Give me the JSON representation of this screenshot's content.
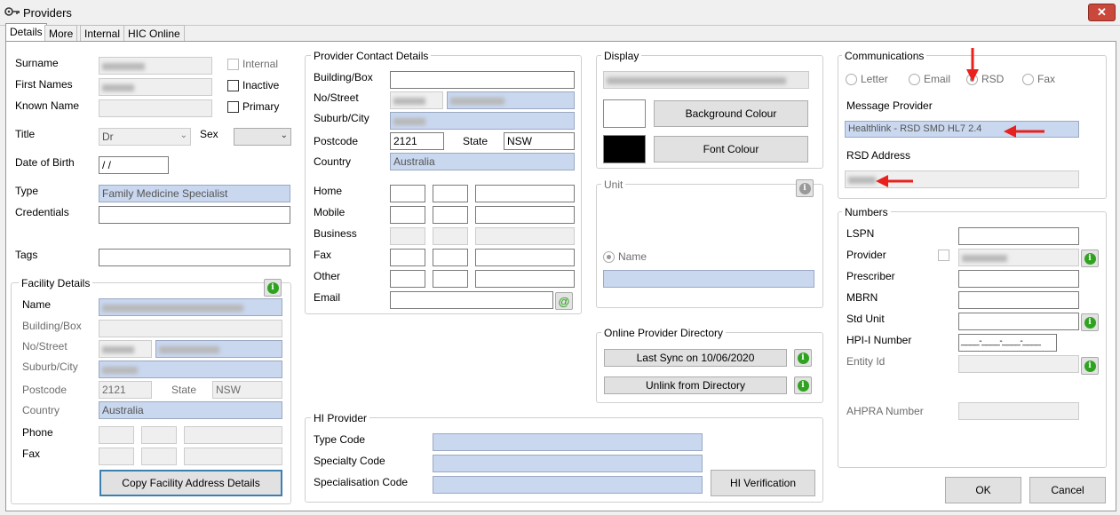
{
  "window": {
    "title": "Providers",
    "close_symbol": "✕"
  },
  "tabs": [
    "Details",
    "More",
    "Internal",
    "HIC Online"
  ],
  "personal": {
    "surname_label": "Surname",
    "first_names_label": "First Names",
    "known_name_label": "Known Name",
    "title_label": "Title",
    "title_value": "Dr",
    "sex_label": "Sex",
    "dob_label": "Date of Birth",
    "dob_value": " /  /",
    "type_label": "Type",
    "type_value": "Family Medicine Specialist",
    "credentials_label": "Credentials",
    "tags_label": "Tags",
    "internal_label": "Internal",
    "inactive_label": "Inactive",
    "primary_label": "Primary"
  },
  "facility": {
    "group_title": "Facility Details",
    "name_label": "Name",
    "building_label": "Building/Box",
    "street_label": "No/Street",
    "suburb_label": "Suburb/City",
    "postcode_label": "Postcode",
    "postcode_value": "2121",
    "state_label": "State",
    "state_value": "NSW",
    "country_label": "Country",
    "country_value": "Australia",
    "phone_label": "Phone",
    "fax_label": "Fax",
    "copy_button": "Copy Facility Address Details"
  },
  "contact": {
    "group_title": "Provider Contact Details",
    "building_label": "Building/Box",
    "street_label": "No/Street",
    "suburb_label": "Suburb/City",
    "postcode_label": "Postcode",
    "postcode_value": "2121",
    "state_label": "State",
    "state_value": "NSW",
    "country_label": "Country",
    "country_value": "Australia",
    "home_label": "Home",
    "mobile_label": "Mobile",
    "business_label": "Business",
    "fax_label": "Fax",
    "other_label": "Other",
    "email_label": "Email",
    "email_icon": "@"
  },
  "display": {
    "group_title": "Display",
    "background_button": "Background Colour",
    "font_button": "Font Colour",
    "background_color": "#ffffff",
    "font_color": "#000000"
  },
  "unit": {
    "group_title": "Unit",
    "name_label": "Name"
  },
  "directory": {
    "group_title": "Online Provider Directory",
    "sync_button": "Last Sync on 10/06/2020",
    "unlink_button": "Unlink from Directory"
  },
  "hi_provider": {
    "group_title": "HI Provider",
    "type_code_label": "Type Code",
    "specialty_code_label": "Specialty Code",
    "specialisation_code_label": "Specialisation Code",
    "verification_button": "HI Verification"
  },
  "communications": {
    "group_title": "Communications",
    "letter_label": "Letter",
    "email_label": "Email",
    "rsd_label": "RSD",
    "fax_label": "Fax",
    "message_provider_label": "Message Provider",
    "message_provider_value": "Healthlink - RSD SMD HL7 2.4",
    "rsd_address_label": "RSD Address"
  },
  "numbers": {
    "group_title": "Numbers",
    "lspn_label": "LSPN",
    "provider_label": "Provider",
    "prescriber_label": "Prescriber",
    "mbrn_label": "MBRN",
    "std_unit_label": "Std Unit",
    "hpii_label": "HPI-I Number",
    "hpii_mask": "____-____-____-____",
    "entity_label": "Entity Id",
    "ahpra_label": "AHPRA Number"
  },
  "actions": {
    "ok": "OK",
    "cancel": "Cancel"
  },
  "info_icon": "i",
  "colors": {
    "accent_arrow": "#e8201e",
    "info_green": "#2fa31f"
  }
}
